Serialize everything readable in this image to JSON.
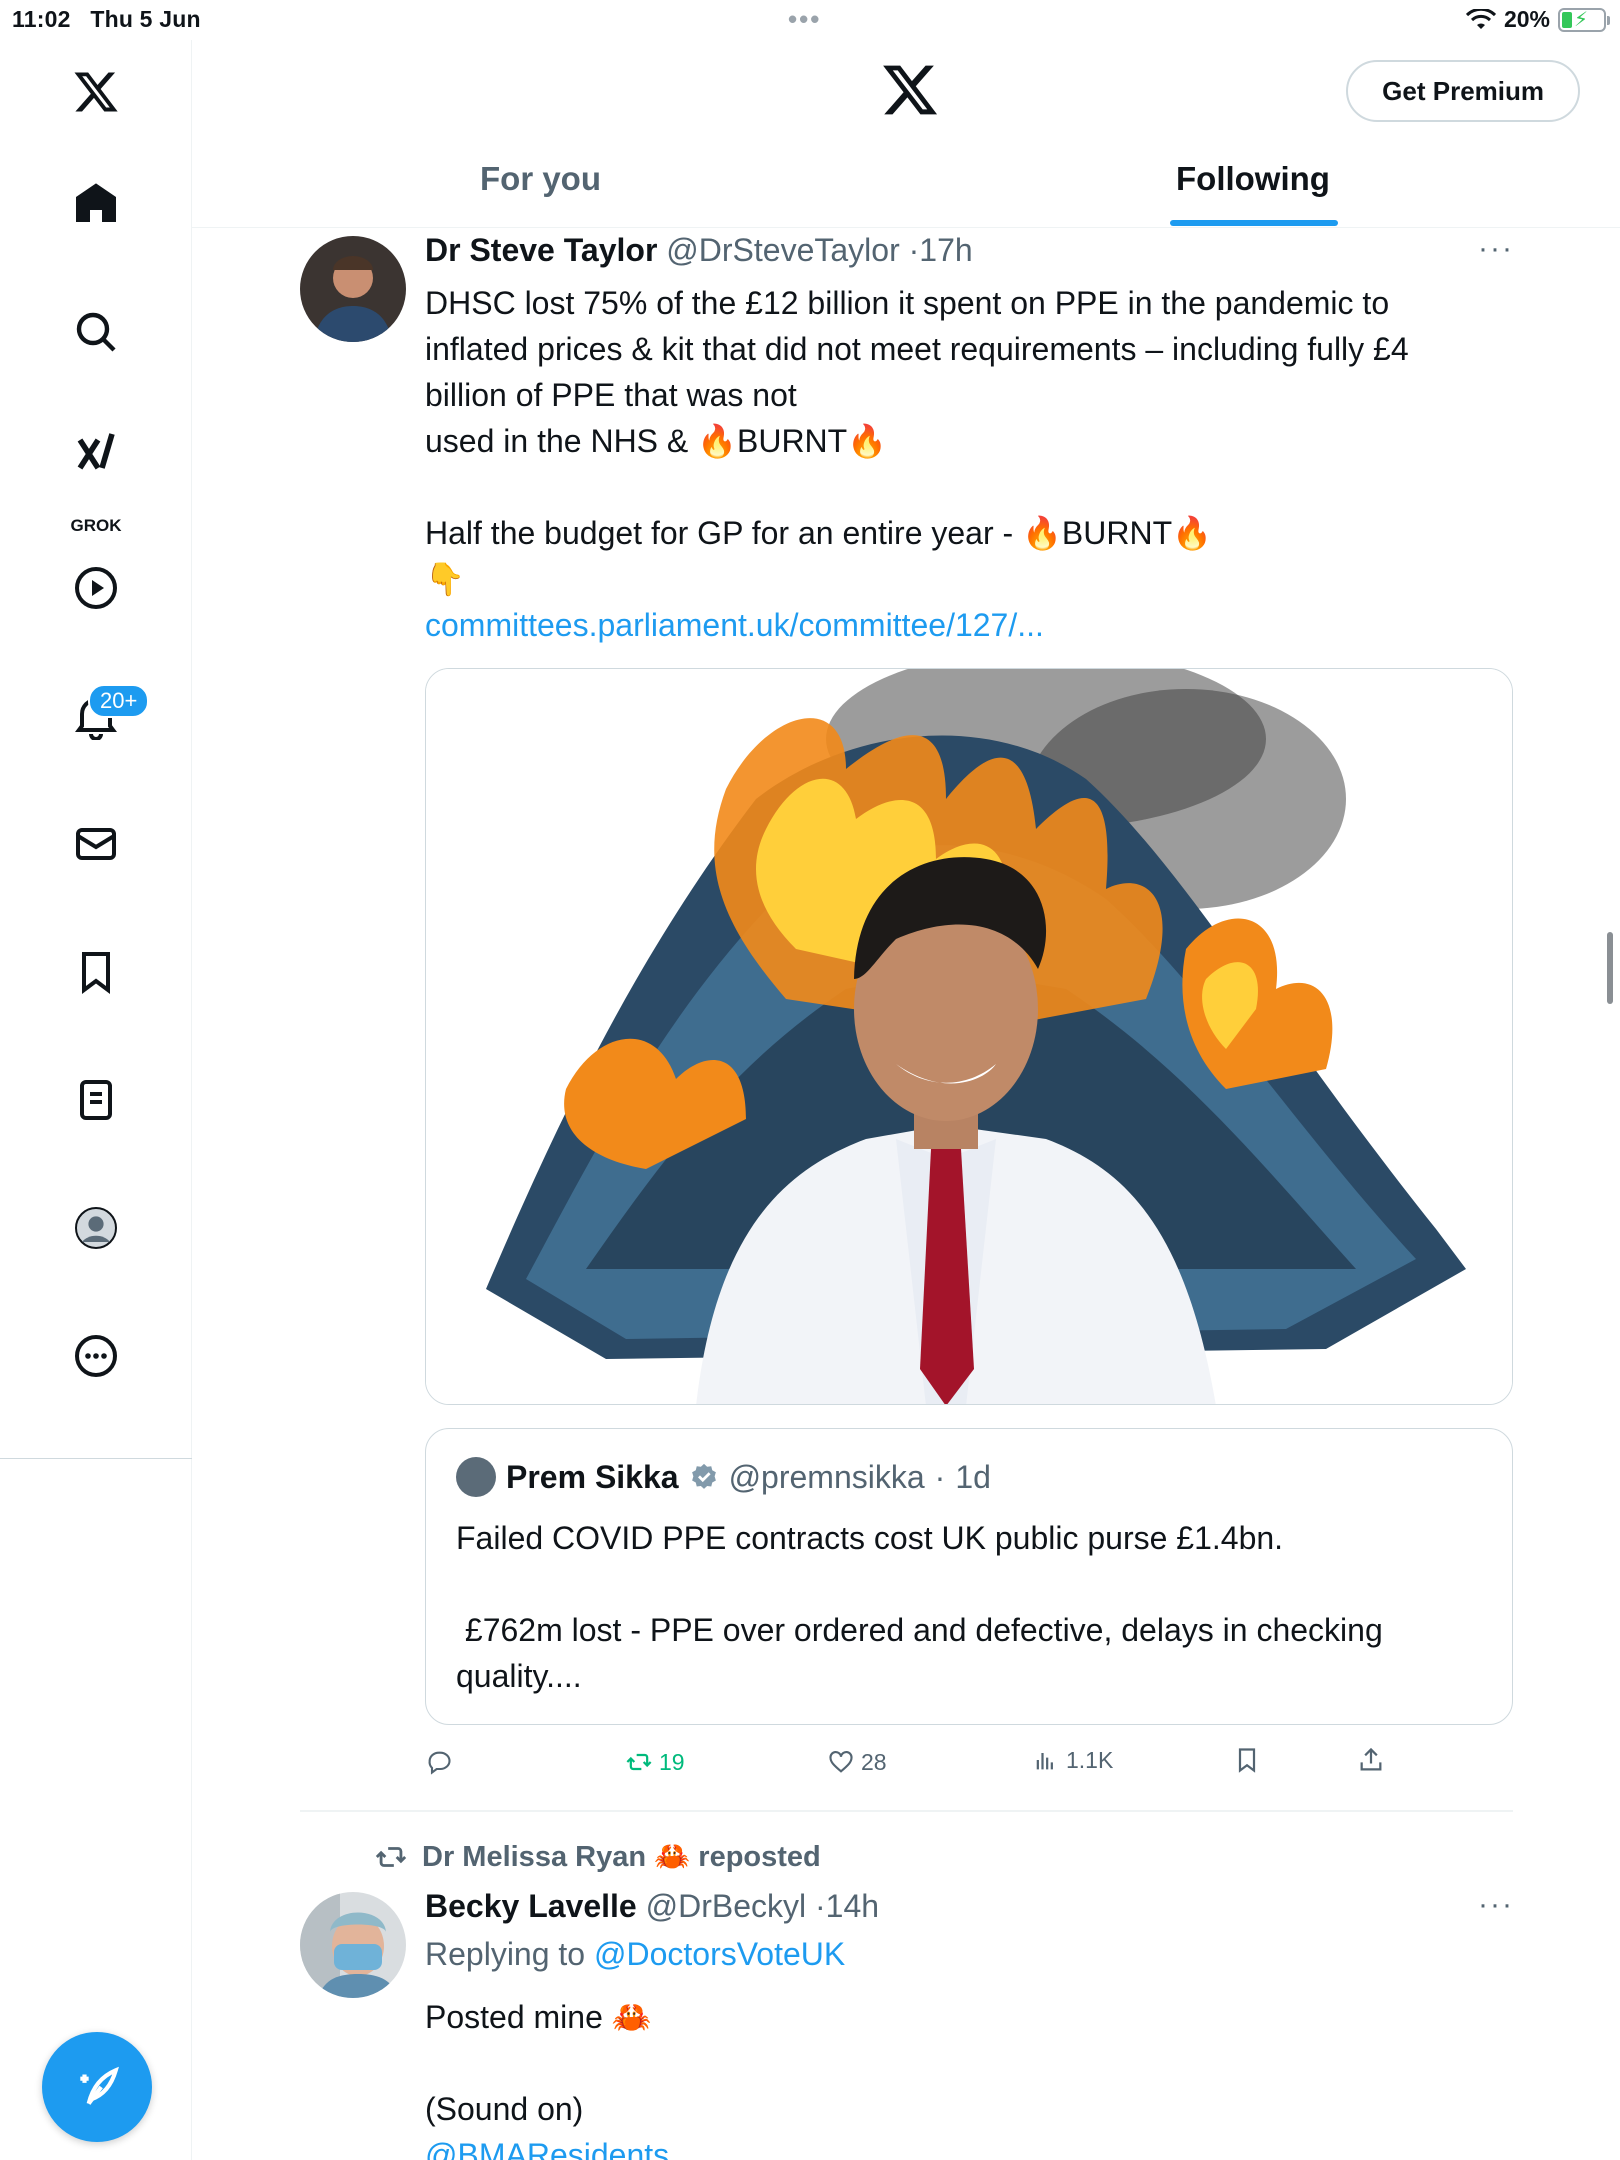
{
  "status_bar": {
    "time": "11:02",
    "date": "Thu 5 Jun",
    "battery": "20%"
  },
  "sidebar": {
    "grok_label": "GROK",
    "notifications_badge": "20+"
  },
  "header": {
    "premium_button": "Get Premium",
    "tabs": [
      {
        "label": "For you",
        "active": false
      },
      {
        "label": "Following",
        "active": true
      }
    ]
  },
  "tweet1": {
    "name": "Dr Steve Taylor",
    "handle": "@DrSteveTaylor",
    "time": "17h",
    "text_line1": "DHSC lost 75% of the £12 billion it spent on PPE in the pandemic to",
    "text_line2": "inflated prices & kit that did not meet requirements – including fully £4",
    "text_line3": "billion of PPE that was not",
    "text_line4a": "used in the NHS & ",
    "text_line4b": "BURNT",
    "text_line5a": "Half the budget for GP for an entire year - ",
    "text_line5b": "BURNT",
    "link": "committees.parliament.uk/committee/127/...",
    "quote": {
      "name": "Prem Sikka",
      "handle": "@premnsikka",
      "time": "1d",
      "text_line1": "Failed COVID PPE contracts cost UK public purse £1.4bn.",
      "text_line2": " £762m lost - PPE over ordered and defective, delays in checking",
      "text_line3": "quality...."
    },
    "actions": {
      "replies": "",
      "retweets": "19",
      "likes": "28",
      "views": "1.1K"
    }
  },
  "tweet2": {
    "reposted_by": "Dr Melissa Ryan",
    "reposted_label": "reposted",
    "name": "Becky Lavelle",
    "handle": "@DrBeckyl",
    "time": "14h",
    "replying_to_label": "Replying to",
    "replying_to": "@DoctorsVoteUK",
    "text_line1": "Posted mine",
    "text_line2": "(Sound on)",
    "text_line3": "@BMAResidents"
  },
  "colors": {
    "accent": "#1d9bf0",
    "retweet": "#00ba7c",
    "secondary": "#536471"
  }
}
